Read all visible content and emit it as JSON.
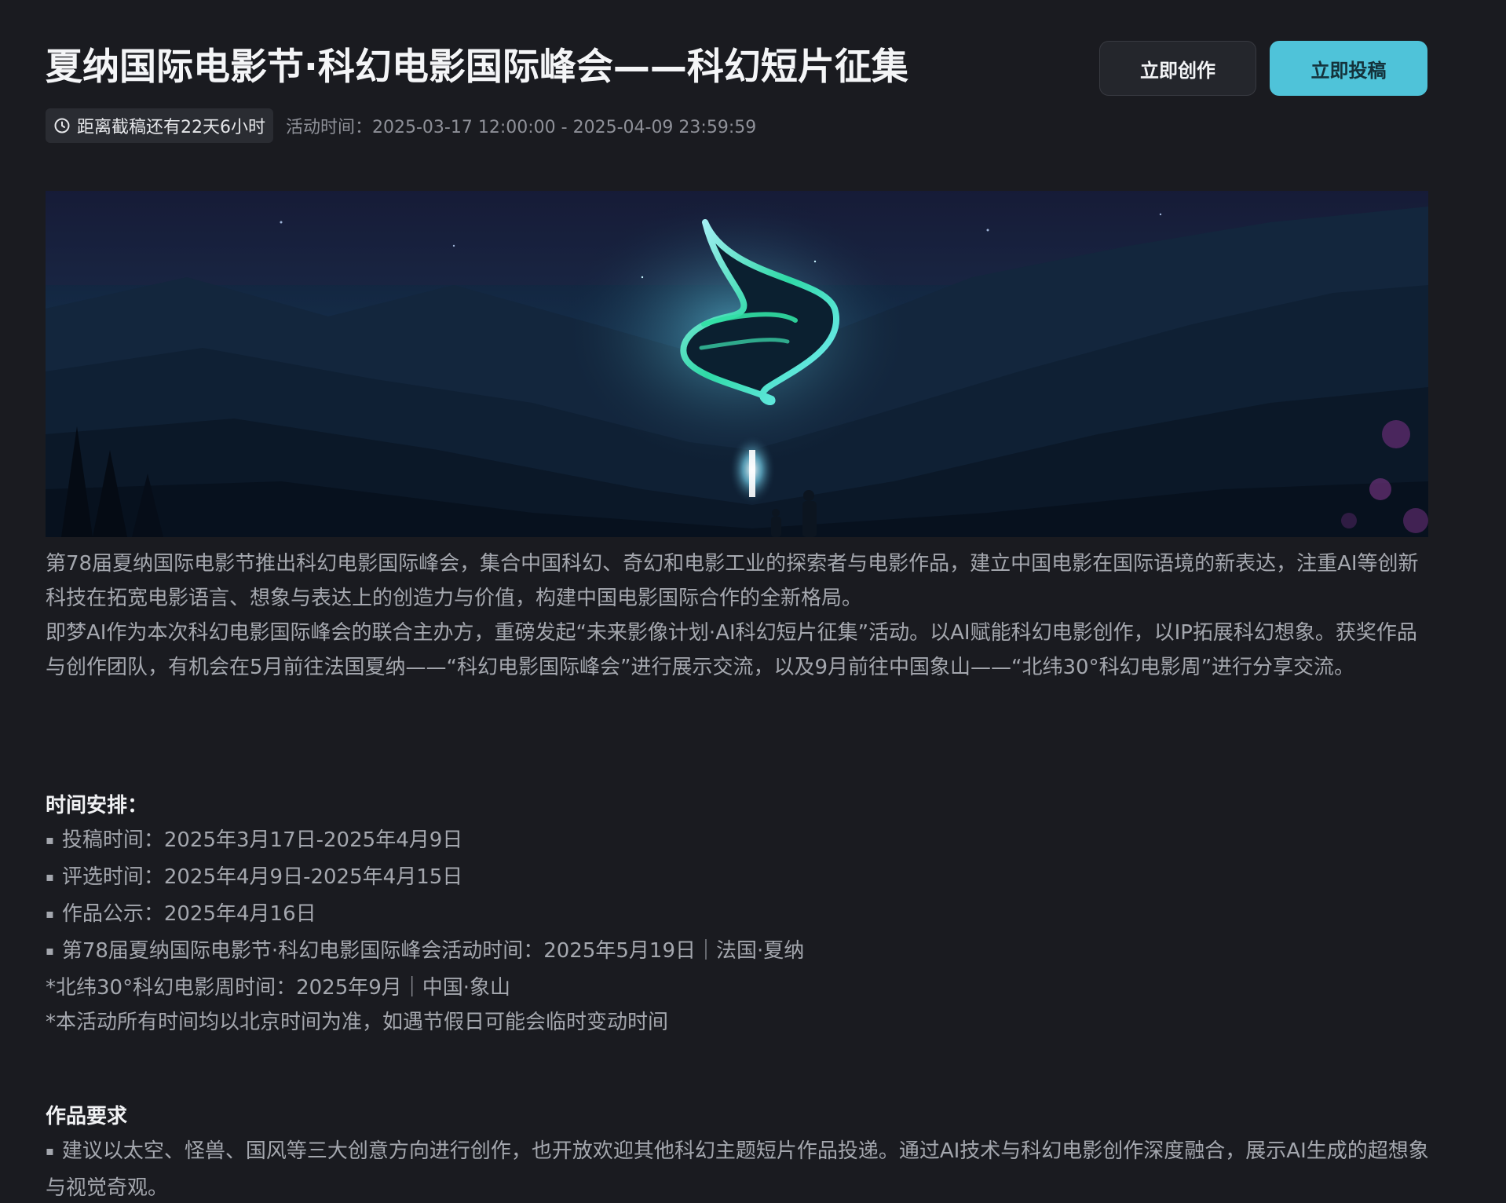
{
  "header": {
    "title": "夏纳国际电影节·科幻电影国际峰会——科幻短片征集",
    "create_label": "立即创作",
    "submit_label": "立即投稿",
    "deadline": "距离截稿还有22天6小时",
    "activity_time": "活动时间：2025-03-17 12:00:00 - 2025-04-09 23:59:59"
  },
  "banner": {
    "description": "night valley with glowing swirl sign and people"
  },
  "intro": {
    "p1": "第78届夏纳国际电影节推出科幻电影国际峰会，集合中国科幻、奇幻和电影工业的探索者与电影作品，建立中国电影在国际语境的新表达，注重AI等创新科技在拓宽电影语言、想象与表达上的创造力与价值，构建中国电影国际合作的全新格局。",
    "p2": "即梦AI作为本次科幻电影国际峰会的联合主办方，重磅发起“未来影像计划·AI科幻短片征集”活动。以AI赋能科幻电影创作，以IP拓展科幻想象。获奖作品与创作团队，有机会在5月前往法国夏纳——“科幻电影国际峰会”进行展示交流，以及9月前往中国象山——“北纬30°科幻电影周”进行分享交流。"
  },
  "schedule": {
    "heading": "时间安排：",
    "items": [
      "投稿时间：2025年3月17日-2025年4月9日",
      "评选时间：2025年4月9日-2025年4月15日",
      "作品公示：2025年4月16日",
      "第78届夏纳国际电影节·科幻电影国际峰会活动时间：2025年5月19日｜法国·夏纳"
    ],
    "notes": [
      "*北纬30°科幻电影周时间：2025年9月｜中国·象山",
      "*本活动所有时间均以北京时间为准，如遇节假日可能会临时变动时间"
    ]
  },
  "requirements": {
    "heading": "作品要求",
    "items": [
      "建议以太空、怪兽、国风等三大创意方向进行创作，也开放欢迎其他科幻主题短片作品投递。通过AI技术与科幻电影创作深度融合，展示AI生成的超想象与视觉奇观。"
    ]
  },
  "colors": {
    "background": "#1a1b20",
    "accent": "#4fc3d9",
    "title": "#f4f5f7",
    "body": "#a4a7ae"
  }
}
